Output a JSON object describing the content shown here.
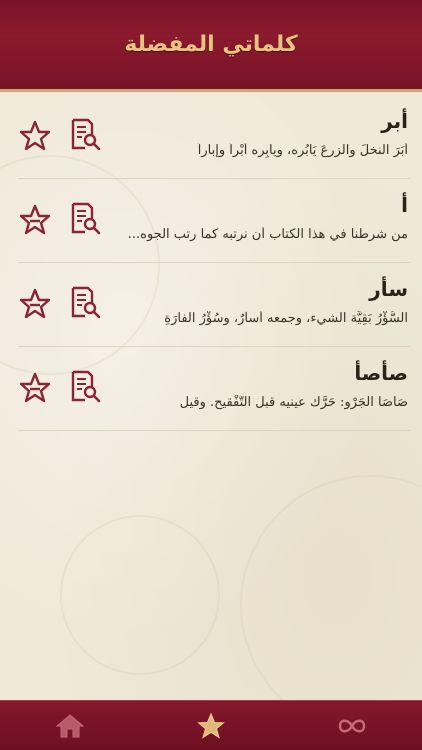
{
  "header": {
    "title": "كلماتي المفضلة"
  },
  "entries": [
    {
      "word": "أبر",
      "definition": "أَبَرَ النخلَ والزرعَ يَأْبُره، ويأْبِره أَبْراً وإِباراً"
    },
    {
      "word": "أ",
      "definition": "من شرطنا في هذا الكتاب أَن نرتبه كما رتب الجوه..."
    },
    {
      "word": "سأر",
      "definition": "السُّؤْرُ بَقِيَّة الشيء، وجمعه أَسآرٌ، وسُؤْرُ الفأْرَةِ"
    },
    {
      "word": "صأصأ",
      "definition": "صَأْصَأَ الجَرْو: حَرَّك عينيه قبل التَّفْقيح. وقيل"
    }
  ],
  "icons": {
    "favorite": "star-outline-icon",
    "view": "document-search-icon"
  },
  "tabs": [
    {
      "name": "home",
      "icon": "home-icon"
    },
    {
      "name": "favorites",
      "icon": "star-icon",
      "active": true
    },
    {
      "name": "more",
      "icon": "infinity-icon"
    }
  ],
  "colors": {
    "brand": "#7a1228",
    "gold": "#e8c47f",
    "icon": "#8b2436",
    "background": "#efe9d9"
  }
}
